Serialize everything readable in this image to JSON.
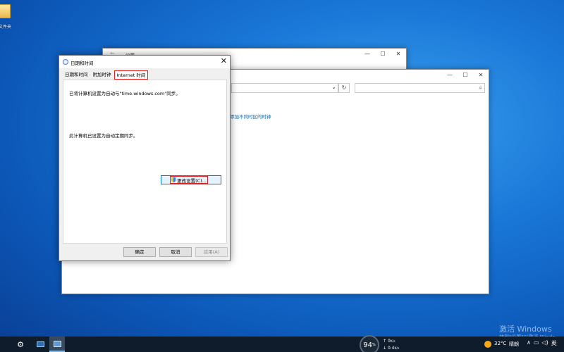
{
  "desktop": {
    "icon_label": "文件夹"
  },
  "settings_window": {
    "back_glyph": "←",
    "title": "设置",
    "controls": [
      "—",
      "☐",
      "✕"
    ]
  },
  "explorer_window": {
    "controls": [
      "—",
      "☐",
      "✕"
    ],
    "address_chevron": "⌄",
    "refresh_glyph": "↻",
    "search_glyph": "⌕",
    "link_text": "添加不同时区的时钟"
  },
  "dialog": {
    "title": "日期和时间",
    "close_glyph": "✕",
    "tabs": [
      {
        "label": "日期和时间"
      },
      {
        "label": "附加时钟"
      },
      {
        "label": "Internet 时间"
      }
    ],
    "selected_tab": 2,
    "panel": {
      "line1": "已将计算机设置为自动与\"time.windows.com\"同步。",
      "line2": "此计算机已设置为自动定期同步。",
      "change_button": "更改设置(C)..."
    },
    "buttons": {
      "ok": "确定",
      "cancel": "取消",
      "apply": "应用(A)"
    }
  },
  "watermark": {
    "line1": "激活 Windows",
    "line2": "转到\"设置\"以激活 Windo"
  },
  "taskbar": {
    "gauge_value": "94",
    "gauge_unit": "%",
    "net_up": "0",
    "net_up_unit": "K/s",
    "net_down": "0.4",
    "net_down_unit": "K/s",
    "net_up_arrow": "↑",
    "net_down_arrow": "↓",
    "weather_temp": "32°C",
    "weather_condition": "晴朗",
    "tray_chevron": "∧",
    "language": "英"
  },
  "colors": {
    "accent": "#0078d7",
    "highlight_red": "#e02020",
    "link_blue": "#0067c0"
  }
}
